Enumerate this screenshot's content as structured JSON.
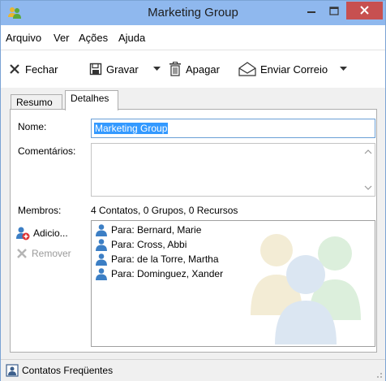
{
  "window": {
    "title": "Marketing Group"
  },
  "menu": [
    "Arquivo",
    "Ver",
    "Ações",
    "Ajuda"
  ],
  "toolbar": {
    "close_label": "Fechar",
    "save_label": "Gravar",
    "delete_label": "Apagar",
    "send_label": "Enviar Correio"
  },
  "tabs": {
    "summary": "Resumo",
    "details": "Detalhes"
  },
  "form": {
    "name_label": "Nome:",
    "name_value": "Marketing Group",
    "comments_label": "Comentários:",
    "comments_value": "",
    "members_label": "Membros:",
    "members_summary": "4 Contatos, 0 Grupos, 0 Recursos",
    "add_label": "Adicio...",
    "remove_label": "Remover"
  },
  "members": [
    "Para: Bernard, Marie",
    "Para: Cross, Abbi",
    "Para: de la Torre, Martha",
    "Para: Dominguez, Xander"
  ],
  "statusbar": {
    "label": "Contatos Freqüentes"
  },
  "colors": {
    "titlebar": "#8fb8ee",
    "close_button": "#c75050",
    "selection": "#3399ff",
    "contact_icon": "#3c7fc5"
  }
}
